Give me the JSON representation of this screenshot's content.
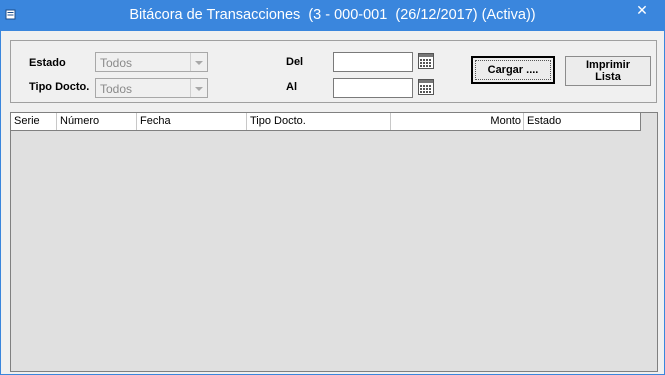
{
  "window": {
    "title": "Bitácora de Transacciones  (3 - 000-001  (26/12/2017) (Activa))",
    "close_glyph": "✕",
    "colors": {
      "titlebar": "#3a86dd",
      "client": "#f0f0f0",
      "grid_background": "#e0e0e0"
    }
  },
  "filters": {
    "estado_label": "Estado",
    "estado_value": "Todos",
    "tipo_docto_label": "Tipo Docto.",
    "tipo_docto_value": "Todos",
    "del_label": "Del",
    "del_value": "",
    "al_label": "Al",
    "al_value": ""
  },
  "buttons": {
    "cargar": "Cargar ....",
    "imprimir_line1": "Imprimir",
    "imprimir_line2": "Lista"
  },
  "table": {
    "columns": [
      "Serie",
      "Número",
      "Fecha",
      "Tipo Docto.",
      "Monto",
      "Estado"
    ],
    "rows": []
  },
  "icons": {
    "app": "app-icon",
    "calendar": "calendar-icon",
    "dropdown": "chevron-down-icon",
    "close": "close-icon"
  }
}
